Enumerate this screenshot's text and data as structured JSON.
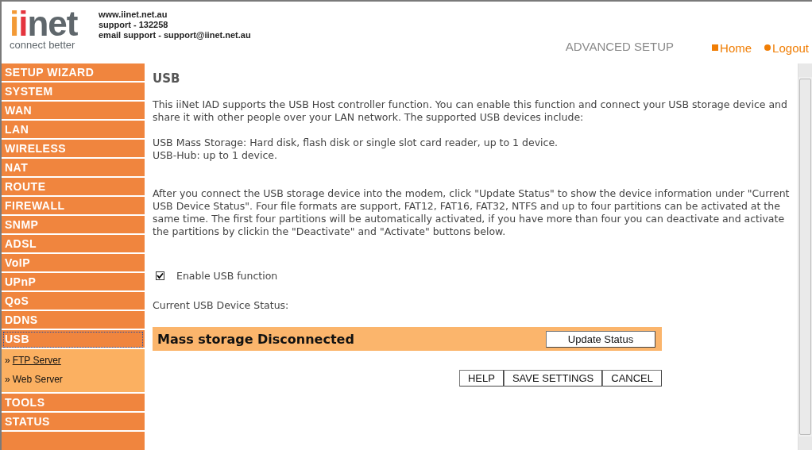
{
  "header": {
    "logo": {
      "word": "iinet",
      "tagline": "connect better"
    },
    "contact": [
      "www.iinet.net.au",
      "support - 132258",
      "email support - support@iinet.net.au"
    ],
    "section_title": "ADVANCED SETUP",
    "links": [
      {
        "kind": "square",
        "label": "Home"
      },
      {
        "kind": "dot",
        "label": "Logout"
      }
    ]
  },
  "sidebar": {
    "items": [
      {
        "label": "SETUP WIZARD",
        "selected": false
      },
      {
        "label": "SYSTEM",
        "selected": false
      },
      {
        "label": "WAN",
        "selected": false
      },
      {
        "label": "LAN",
        "selected": false
      },
      {
        "label": "WIRELESS",
        "selected": false
      },
      {
        "label": "NAT",
        "selected": false
      },
      {
        "label": "ROUTE",
        "selected": false
      },
      {
        "label": "FIREWALL",
        "selected": false
      },
      {
        "label": "SNMP",
        "selected": false
      },
      {
        "label": "ADSL",
        "selected": false
      },
      {
        "label": "VoIP",
        "selected": false
      },
      {
        "label": "UPnP",
        "selected": false
      },
      {
        "label": "QoS",
        "selected": false
      },
      {
        "label": "DDNS",
        "selected": false
      },
      {
        "label": "USB",
        "selected": true,
        "children": [
          {
            "marker": "»",
            "label": "FTP Server",
            "selected": true
          },
          {
            "marker": "»",
            "label": "Web Server",
            "selected": false
          }
        ]
      },
      {
        "label": "TOOLS",
        "selected": false
      },
      {
        "label": "STATUS",
        "selected": false
      }
    ]
  },
  "content": {
    "title": "USB",
    "paragraphs": [
      [
        "This iiNet IAD supports the USB Host controller function. You can enable this function and connect your USB storage device and share it with other people over your LAN network. The supported USB devices include:"
      ],
      [
        "USB Mass Storage: Hard disk, flash disk or single slot card reader, up to 1 device.",
        "USB-Hub: up to 1 device."
      ],
      [
        "After you connect the USB storage device into the modem, click \"Update Status\" to show the device information under \"Current USB Device Status\". Four file formats are support, FAT12, FAT16, FAT32, NTFS and up to four partitions can be activated at the same time. The first four partitions will be automatically activated, if you have more than four you can deactivate and activate the partitions by clickin the \"Deactivate\" and \"Activate\" buttons below."
      ]
    ],
    "enable_usb": {
      "label": "Enable USB function",
      "checked": true
    },
    "status_label": "Current USB Device Status:",
    "status_bar": {
      "text": "Mass storage Disconnected",
      "button": "Update Status"
    },
    "buttons": [
      "HELP",
      "SAVE SETTINGS",
      "CANCEL"
    ]
  }
}
